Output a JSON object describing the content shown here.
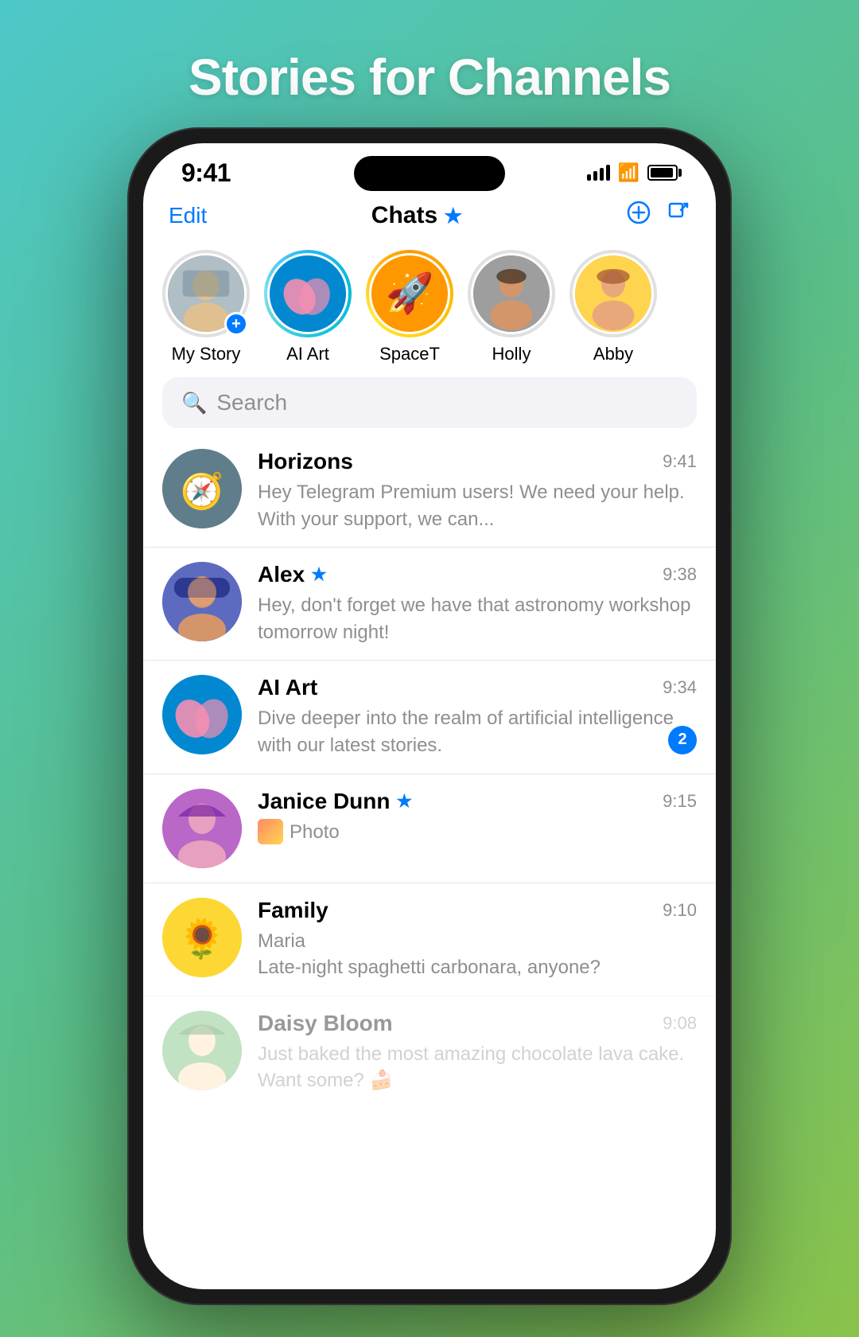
{
  "page": {
    "title": "Stories for Channels"
  },
  "status": {
    "time": "9:41"
  },
  "nav": {
    "edit": "Edit",
    "title": "Chats"
  },
  "stories": [
    {
      "id": "my-story",
      "label": "My Story",
      "ring": "plain",
      "hasAdd": true,
      "avatar": "my-story"
    },
    {
      "id": "ai-art",
      "label": "AI Art",
      "ring": "gradient",
      "hasAdd": false,
      "avatar": "ai-art"
    },
    {
      "id": "spacet",
      "label": "SpaceT",
      "ring": "gradient",
      "hasAdd": false,
      "avatar": "spacet"
    },
    {
      "id": "holly",
      "label": "Holly",
      "ring": "plain",
      "hasAdd": false,
      "avatar": "holly"
    },
    {
      "id": "abby",
      "label": "Abby",
      "ring": "plain",
      "hasAdd": false,
      "avatar": "abby"
    }
  ],
  "search": {
    "placeholder": "Search"
  },
  "chats": [
    {
      "id": "horizons",
      "name": "Horizons",
      "time": "9:41",
      "preview": "Hey Telegram Premium users!  We need your help. With your support, we can...",
      "hasStar": false,
      "badge": null,
      "avatar": "horizons"
    },
    {
      "id": "alex",
      "name": "Alex",
      "time": "9:38",
      "preview": "Hey, don't forget we have that astronomy workshop tomorrow night!",
      "hasStar": true,
      "badge": null,
      "avatar": "alex"
    },
    {
      "id": "ai-art",
      "name": "AI Art",
      "time": "9:34",
      "preview": "Dive deeper into the realm of artificial intelligence with our latest stories.",
      "hasStar": false,
      "badge": "2",
      "avatar": "aiart"
    },
    {
      "id": "janice",
      "name": "Janice Dunn",
      "time": "9:15",
      "preview": "Photo",
      "isPhoto": true,
      "hasStar": true,
      "badge": null,
      "avatar": "janice"
    },
    {
      "id": "family",
      "name": "Family",
      "time": "9:10",
      "preview": "Maria\nLate-night spaghetti carbonara, anyone?",
      "hasStar": false,
      "badge": null,
      "avatar": "family"
    },
    {
      "id": "daisy",
      "name": "Daisy Bloom",
      "time": "9:08",
      "preview": "Just baked the most amazing chocolate lava cake. Want some? 🍰",
      "hasStar": false,
      "badge": null,
      "avatar": "daisy",
      "faded": true
    }
  ]
}
